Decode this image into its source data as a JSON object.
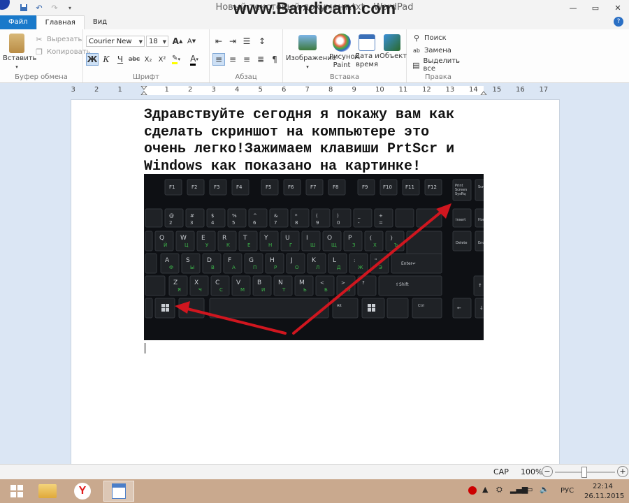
{
  "window": {
    "title": "Новый текстовый документ.txt - WordPad",
    "watermark": "www.Bandicam.com"
  },
  "tabs": [
    {
      "label": "Файл"
    },
    {
      "label": "Главная"
    },
    {
      "label": "Вид"
    }
  ],
  "help_label": "?",
  "ribbon": {
    "clipboard": {
      "paste_label": "Вставить",
      "cut_label": "Вырезать",
      "copy_label": "Копировать",
      "group_label": "Буфер обмена"
    },
    "font": {
      "family": "Courier New",
      "size": "18",
      "bold_label": "Ж",
      "italic_label": "К",
      "underline_label": "Ч",
      "strike_label": "abc",
      "subscript_label": "X₂",
      "superscript_label": "X²",
      "grow_label": "A",
      "shrink_label": "A",
      "color_label": "A",
      "group_label": "Шрифт"
    },
    "paragraph": {
      "group_label": "Абзац"
    },
    "insert": {
      "image_label": "Изображение",
      "paint_label_1": "Рисунок",
      "paint_label_2": "Paint",
      "datetime_label_1": "Дата и",
      "datetime_label_2": "время",
      "object_label": "Объект",
      "group_label": "Вставка"
    },
    "edit": {
      "find_label": "Поиск",
      "replace_label": "Замена",
      "select_all_label": "Выделить все",
      "group_label": "Правка"
    }
  },
  "ruler": {
    "numbers": [
      "3",
      "2",
      "1",
      "1",
      "2",
      "3",
      "4",
      "5",
      "6",
      "7",
      "8",
      "9",
      "10",
      "11",
      "12",
      "13",
      "14",
      "15",
      "16",
      "17"
    ]
  },
  "document": {
    "text": "Здравствуйте сегодня я покажу вам как сделать скриншот на компьютере это очень легко!Зажимаем клавиши PrtScr и Windows как показано на картинке!"
  },
  "statusbar": {
    "caps": "CAP",
    "zoom": "100%",
    "zoom_minus": "−",
    "zoom_plus": "+"
  },
  "taskbar": {
    "language": "РУС",
    "time": "22:14",
    "date": "26.11.2015"
  },
  "colors": {
    "file_tab": "#1979ca",
    "taskbar": "#c9a98e",
    "arrow": "#d0161f"
  }
}
